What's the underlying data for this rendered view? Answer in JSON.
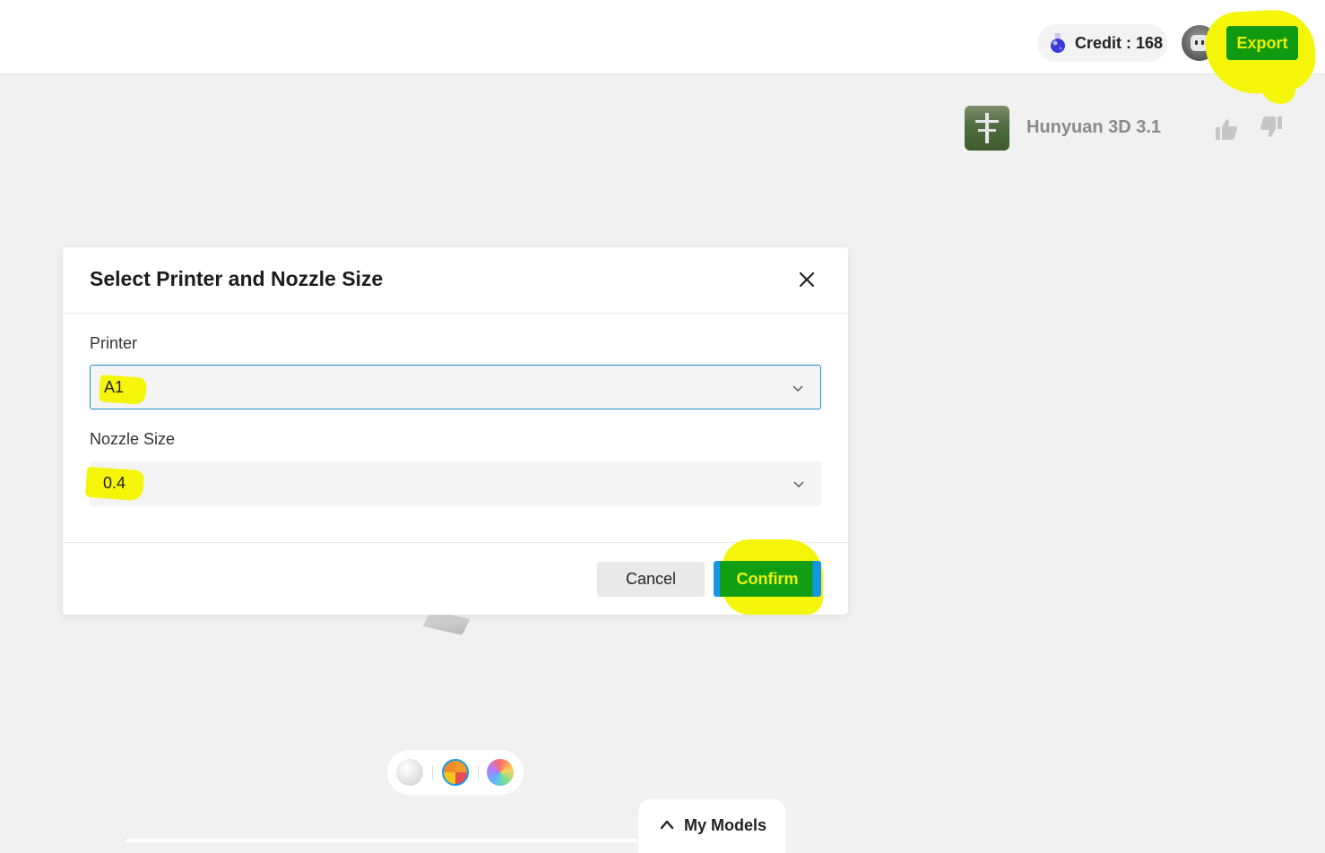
{
  "header": {
    "credit_label": "Credit : 168",
    "export_label": "Export"
  },
  "model": {
    "name": "Hunyuan 3D 3.1"
  },
  "dialog": {
    "title": "Select Printer and Nozzle Size",
    "printer_label": "Printer",
    "printer_value": "A1",
    "nozzle_label": "Nozzle Size",
    "nozzle_value": "0.4",
    "cancel_label": "Cancel",
    "confirm_label": "Confirm"
  },
  "materials": [
    "white",
    "multicolor",
    "rainbow"
  ],
  "footer": {
    "my_models_label": "My Models"
  },
  "colors": {
    "highlight": "#f5f50a",
    "button_green": "#0f9a0f",
    "focus_border": "#1a8fc0",
    "accent_blue": "#1296e8"
  },
  "icons": [
    "potion-icon",
    "avatar-icon",
    "thumbs-up-icon",
    "thumbs-down-icon",
    "close-icon",
    "chevron-down-icon",
    "chevron-up-icon"
  ]
}
